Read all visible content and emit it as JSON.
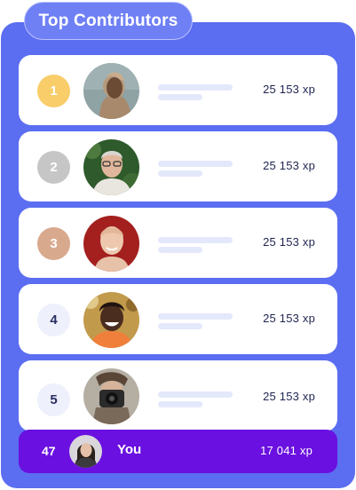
{
  "header": {
    "title": "Top Contributors"
  },
  "contributors": [
    {
      "rank": "1",
      "xp": "25 153 xp",
      "medal": "gold",
      "avatar_icon": "user-avatar-icon"
    },
    {
      "rank": "2",
      "xp": "25 153 xp",
      "medal": "silver",
      "avatar_icon": "user-avatar-icon"
    },
    {
      "rank": "3",
      "xp": "25 153 xp",
      "medal": "bronze",
      "avatar_icon": "user-avatar-icon"
    },
    {
      "rank": "4",
      "xp": "25 153 xp",
      "medal": "none",
      "avatar_icon": "user-avatar-icon"
    },
    {
      "rank": "5",
      "xp": "25 153 xp",
      "medal": "none",
      "avatar_icon": "user-avatar-icon"
    }
  ],
  "current_user": {
    "rank": "47",
    "name": "You",
    "xp": "17 041 xp"
  },
  "colors": {
    "panel": "#5b6df0",
    "you_row": "#6a10e0",
    "gold": "#f8cd6a",
    "silver": "#c6c6c6",
    "bronze": "#d9a98e"
  }
}
